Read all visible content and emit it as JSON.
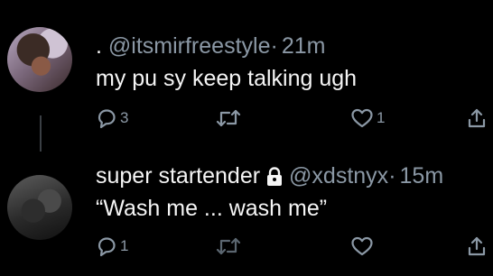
{
  "tweets": [
    {
      "handle_prefix": ".",
      "handle": "@itsmirfreestyle",
      "separator": "·",
      "time": "21m",
      "text": "my pu  sy keep talking ugh",
      "reply_count": "3",
      "retweet_count": "",
      "like_count": "1"
    },
    {
      "display_name": "super startender",
      "protected_icon": "lock-icon",
      "handle": "@xdstnyx",
      "separator": "·",
      "time": "15m",
      "text": "“Wash me ... wash me”",
      "reply_count": "1",
      "retweet_count": "",
      "like_count": ""
    }
  ],
  "icons": {
    "reply": "reply-icon",
    "retweet": "retweet-icon",
    "like": "heart-icon",
    "share": "share-icon"
  },
  "colors": {
    "background": "#000000",
    "text": "#f5f5f5",
    "muted": "#8b98a5",
    "thread_line": "#3a3f44"
  }
}
